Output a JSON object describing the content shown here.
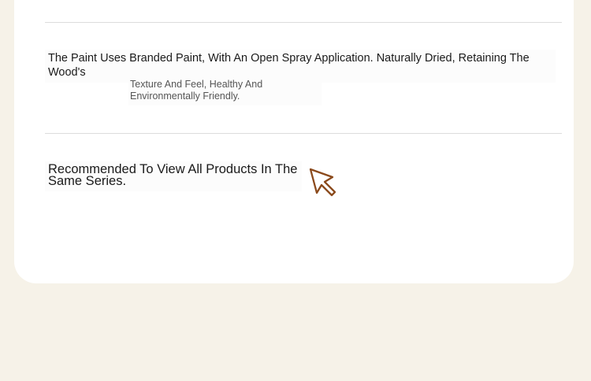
{
  "description": {
    "line1": "The Paint Uses Branded Paint, With An Open Spray Application. Naturally Dried, Retaining The Wood's",
    "line2": "Texture And Feel, Healthy And Environmentally Friendly."
  },
  "recommendation": {
    "text": "Recommended To View All Products In The Same Series.",
    "icon": "cursor-pointer-icon",
    "icon_color": "#8b4a1c"
  },
  "colors": {
    "background": "#f6f2e8",
    "card": "#ffffff",
    "divider": "#dcdcdc"
  }
}
